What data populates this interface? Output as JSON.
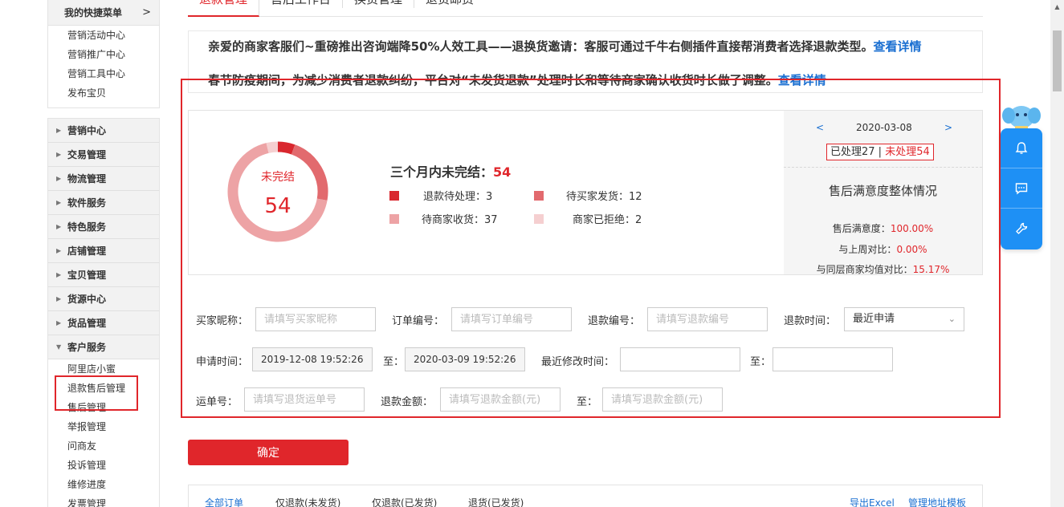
{
  "sidebar": {
    "quick_menu_title": "我的快捷菜单",
    "quick_menu_arrow": ">",
    "quick_items": [
      "营销活动中心",
      "营销推广中心",
      "营销工具中心",
      "发布宝贝"
    ],
    "categories": [
      "营销中心",
      "交易管理",
      "物流管理",
      "软件服务",
      "特色服务",
      "店铺管理",
      "宝贝管理",
      "货源中心",
      "货品管理"
    ],
    "open_category": "客户服务",
    "customer_service_items": [
      "阿里店小蜜",
      "退款售后管理",
      "售后管理",
      "举报管理",
      "问商友",
      "投诉管理",
      "维修进度",
      "发票管理"
    ]
  },
  "top_tabs": [
    "退款管理",
    "售后工作台",
    "换货管理",
    "退货邮费"
  ],
  "notices": {
    "n1_text": "亲爱的商家客服们~重磅推出咨询端降50%人效工具——退换货邀请：客服可通过千牛右侧插件直接帮消费者选择退款类型。",
    "n1_link": "查看详情",
    "n2_text": "春节防疫期间，为减少消费者退款纠纷，平台对“未发货退款”处理时长和等待商家确认收货时长做了调整。",
    "n2_link": "查看详情"
  },
  "stats": {
    "donut_label": "未完结",
    "donut_value": "54",
    "title_prefix": "三个月内未完结：",
    "title_value": "54",
    "legend": [
      {
        "label": "退款待处理：3",
        "value": 3,
        "color": "#d9272e"
      },
      {
        "label": "待买家发货：12",
        "value": 12,
        "color": "#e26a6e"
      },
      {
        "label": "待商家收货：37",
        "value": 37,
        "color": "#eda3a5"
      },
      {
        "label": "商家已拒绝：2",
        "value": 2,
        "color": "#f5cfd0"
      }
    ],
    "date_prev": "<",
    "date": "2020-03-08",
    "date_next": ">",
    "processed": "已处理27",
    "separator": " | ",
    "unprocessed": "未处理54",
    "satisfaction_title": "售后满意度整体情况",
    "sat_rows": [
      {
        "label": "售后满意度：",
        "value": "100.00%"
      },
      {
        "label": "与上周对比：",
        "value": "0.00%"
      },
      {
        "label": "与同层商家均值对比：",
        "value": "15.17%"
      }
    ]
  },
  "form": {
    "buyer_label": "买家昵称：",
    "buyer_ph": "请填写买家昵称",
    "order_label": "订单编号：",
    "order_ph": "请填写订单编号",
    "refund_no_label": "退款编号：",
    "refund_no_ph": "请填写退款编号",
    "refund_time_label": "退款时间：",
    "refund_time_value": "最近申请",
    "apply_time_label": "申请时间：",
    "apply_from": "2019-12-08 19:52:26",
    "to_label": "至：",
    "apply_to": "2020-03-09 19:52:26",
    "modify_time_label": "最近修改时间：",
    "waybill_label": "运单号：",
    "waybill_ph": "请填写退货运单号",
    "amount_label": "退款金额：",
    "amount_ph": "请填写退款金额(元)",
    "amount_to_ph": "请填写退款金额(元)"
  },
  "confirm_label": "确定",
  "bottom_tabs": {
    "all": "全部订单",
    "refund_unshipped": "仅退款(未发货)",
    "refund_shipped": "仅退款(已发货)",
    "return_shipped": "退货(已发货)",
    "export": "导出Excel",
    "address_tpl": "管理地址模板"
  }
}
